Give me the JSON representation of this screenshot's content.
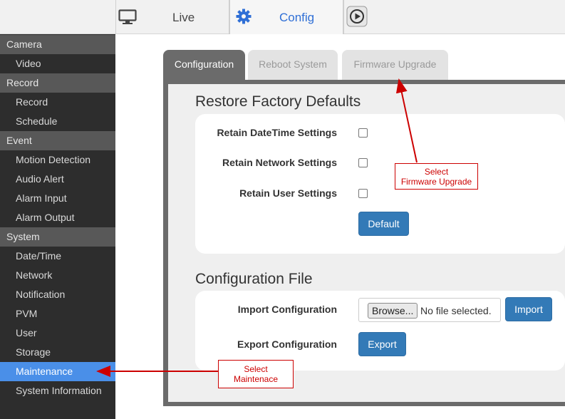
{
  "topbar": {
    "live_label": "Live",
    "config_label": "Config",
    "icons": [
      "monitor-icon",
      "gear-icon",
      "play-icon"
    ],
    "accent_color": "#2f6fd6"
  },
  "sidebar": {
    "items": [
      {
        "label": "Camera",
        "type": "header"
      },
      {
        "label": "Video",
        "type": "item"
      },
      {
        "label": "Record",
        "type": "header"
      },
      {
        "label": "Record",
        "type": "item"
      },
      {
        "label": "Schedule",
        "type": "item"
      },
      {
        "label": "Event",
        "type": "header"
      },
      {
        "label": "Motion Detection",
        "type": "item"
      },
      {
        "label": "Audio Alert",
        "type": "item"
      },
      {
        "label": "Alarm Input",
        "type": "item"
      },
      {
        "label": "Alarm Output",
        "type": "item"
      },
      {
        "label": "System",
        "type": "header"
      },
      {
        "label": "Date/Time",
        "type": "item"
      },
      {
        "label": "Network",
        "type": "item"
      },
      {
        "label": "Notification",
        "type": "item"
      },
      {
        "label": "PVM",
        "type": "item"
      },
      {
        "label": "User",
        "type": "item"
      },
      {
        "label": "Storage",
        "type": "item"
      },
      {
        "label": "Maintenance",
        "type": "item",
        "active": true
      },
      {
        "label": "System Information",
        "type": "item"
      }
    ],
    "active_color": "#4a8fe8"
  },
  "tabs": [
    {
      "label": "Configuration",
      "active": true
    },
    {
      "label": "Reboot System",
      "active": false
    },
    {
      "label": "Firmware Upgrade",
      "active": false
    }
  ],
  "restore": {
    "title": "Restore Factory Defaults",
    "options": [
      {
        "label": "Retain DateTime Settings",
        "checked": false
      },
      {
        "label": "Retain Network Settings",
        "checked": false
      },
      {
        "label": "Retain User Settings",
        "checked": false
      }
    ],
    "default_button": "Default"
  },
  "config_file": {
    "title": "Configuration File",
    "import_label": "Import Configuration",
    "browse_button": "Browse...",
    "file_status": "No file selected.",
    "import_button": "Import",
    "export_label": "Export Configuration",
    "export_button": "Export"
  },
  "annotations": {
    "firmware_callout": [
      "Select",
      "Firmware Upgrade"
    ],
    "maintenance_callout": [
      "Select",
      "Maintenace"
    ],
    "color": "#cc0000"
  }
}
